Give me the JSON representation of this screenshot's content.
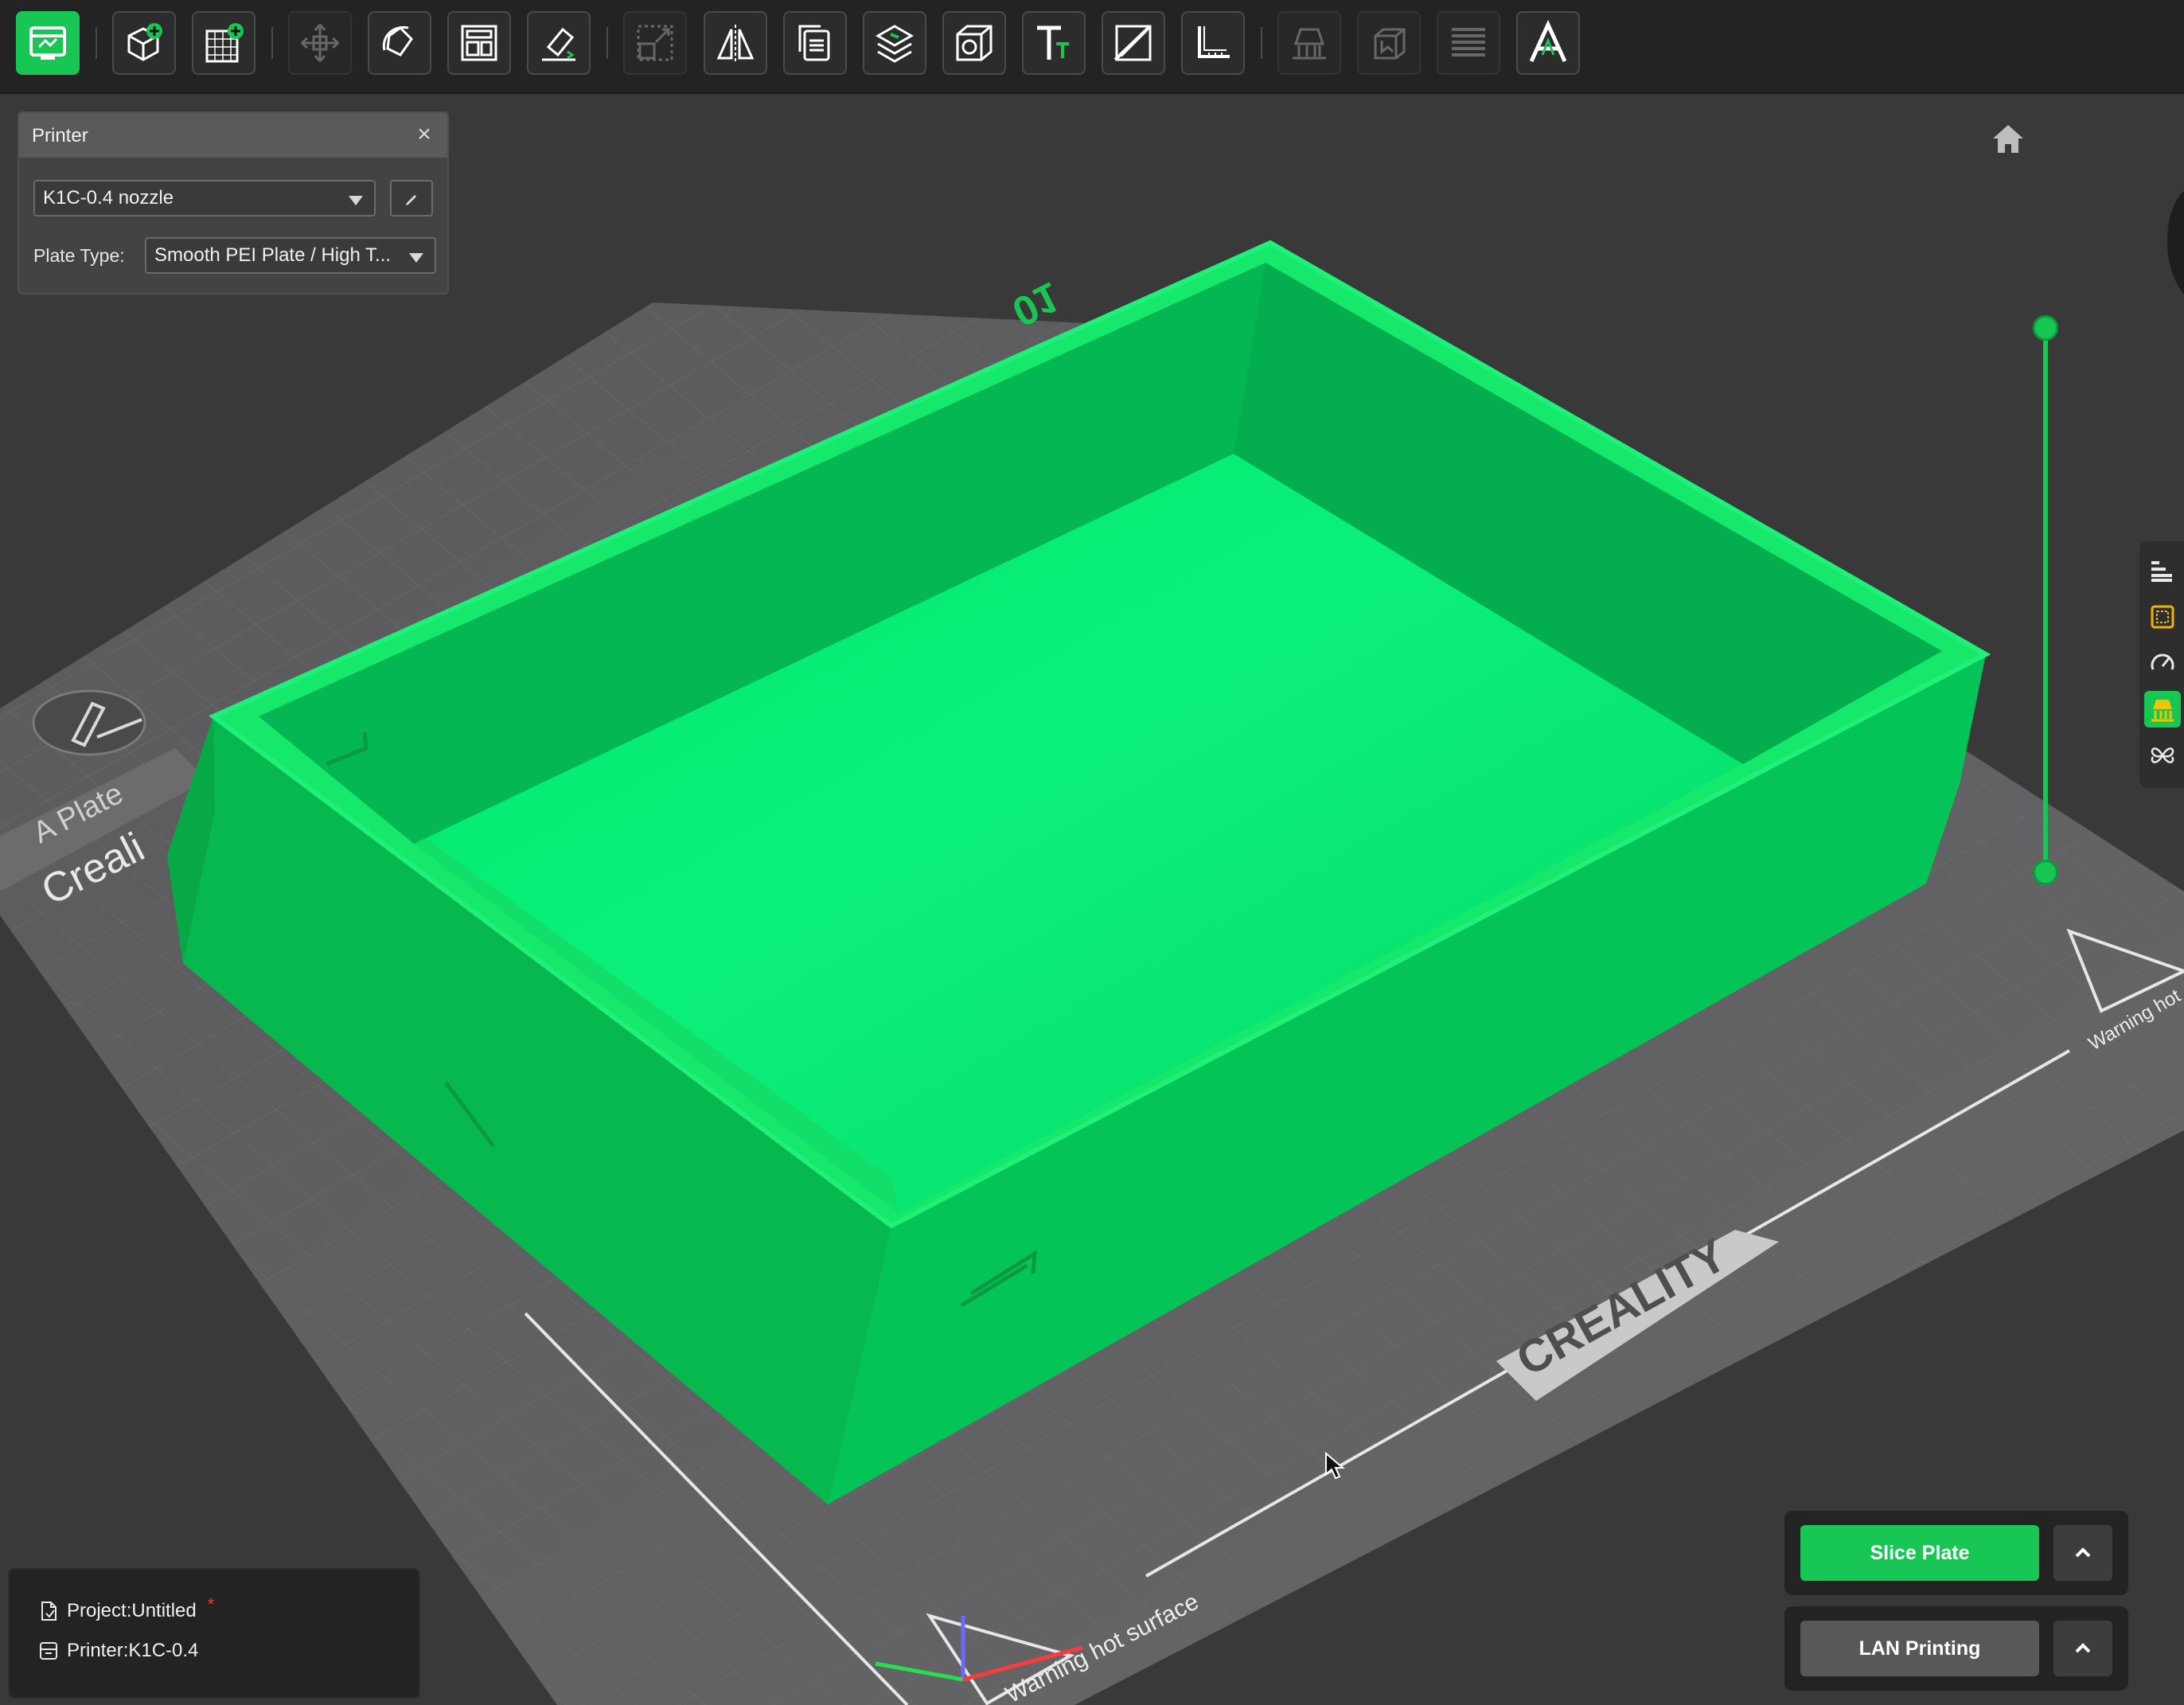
{
  "toolbar": {
    "tools": [
      {
        "name": "prepare-view",
        "active": true
      },
      {
        "name": "add-model"
      },
      {
        "name": "add-plate"
      },
      {
        "name": "auto-orient",
        "dim": true
      },
      {
        "name": "rotate"
      },
      {
        "name": "arrange"
      },
      {
        "name": "lay-on-face"
      },
      {
        "name": "scale",
        "dim": true
      },
      {
        "name": "mirror"
      },
      {
        "name": "copy"
      },
      {
        "name": "split"
      },
      {
        "name": "hollow"
      },
      {
        "name": "text"
      },
      {
        "name": "cut"
      },
      {
        "name": "measure"
      },
      {
        "name": "support-paint",
        "dim": true
      },
      {
        "name": "seam-paint",
        "dim": true
      },
      {
        "name": "layers",
        "dim": true
      },
      {
        "name": "text-emboss"
      }
    ]
  },
  "printer_panel": {
    "title": "Printer",
    "close_icon": "close-icon",
    "printer_value": "K1C-0.4 nozzle",
    "plate_type_label": "Plate Type:",
    "plate_type_value": "Smooth PEI Plate / High T..."
  },
  "viewport": {
    "object_label": "01",
    "plate_tab": "A Plate",
    "bed_brand": "CREALITY",
    "bed_brand_left": "Creali",
    "warning_text": "Warning hot surface",
    "warning_text_right": "Warning hot",
    "model_color": "#17c653"
  },
  "layer_slider": {
    "min": 0,
    "max": 1
  },
  "side_panel": {
    "items": [
      {
        "name": "object-list-icon"
      },
      {
        "name": "plate-settings-icon"
      },
      {
        "name": "speed-icon"
      },
      {
        "name": "support-icon",
        "active": true
      },
      {
        "name": "assembly-icon"
      }
    ]
  },
  "project": {
    "project_label": "Project:Untitled",
    "modified_mark": "*",
    "printer_label": "Printer:K1C-0.4"
  },
  "actions": {
    "slice_label": "Slice Plate",
    "print_label": "LAN Printing"
  },
  "colors": {
    "accent": "#17c653",
    "background": "#393939",
    "toolbar": "#232323"
  }
}
